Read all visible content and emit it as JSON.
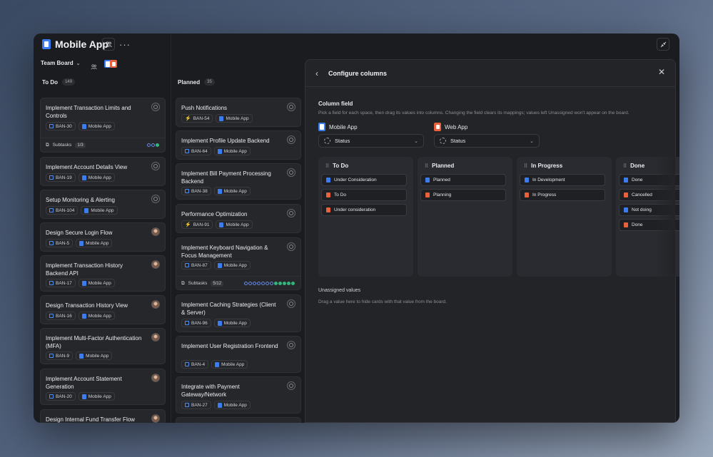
{
  "header": {
    "app_title": "Mobile App",
    "board_name": "Team Board"
  },
  "columns": [
    {
      "name": "To Do",
      "count": "149",
      "cards": [
        {
          "title": "Implement Transaction Limits and Controls",
          "key": "BAN-30",
          "project": "Mobile App",
          "assignee": "empty",
          "subtasks": {
            "label": "Subtasks",
            "count": "1/3",
            "done": 1,
            "total": 3
          }
        },
        {
          "title": "Implement Account Details View",
          "key": "BAN-19",
          "project": "Mobile App",
          "assignee": "empty"
        },
        {
          "title": "Setup Monitoring & Alerting",
          "key": "BAN-104",
          "project": "Mobile App",
          "assignee": "empty"
        },
        {
          "title": "Design Secure Login Flow",
          "key": "BAN-5",
          "project": "Mobile App",
          "assignee": "photo"
        },
        {
          "title": "Implement Transaction History Backend API",
          "key": "BAN-17",
          "project": "Mobile App",
          "assignee": "photo"
        },
        {
          "title": "Design Transaction History View",
          "key": "BAN-16",
          "project": "Mobile App",
          "assignee": "photo"
        },
        {
          "title": "Implement Multi-Factor Authentication (MFA)",
          "key": "BAN-9",
          "project": "Mobile App",
          "assignee": "photo"
        },
        {
          "title": "Implement Account Statement Generation",
          "key": "BAN-20",
          "project": "Mobile App",
          "assignee": "photo"
        },
        {
          "title": "Design Internal Fund Transfer Flow",
          "key": "",
          "project": "",
          "assignee": "photo"
        }
      ]
    },
    {
      "name": "Planned",
      "count": "35",
      "cards": [
        {
          "title": "Push Notifications",
          "key": "BAN-54",
          "project": "Mobile App",
          "assignee": "empty",
          "key_icon": "bolt"
        },
        {
          "title": "Implement Profile Update Backend",
          "key": "BAN-64",
          "project": "Mobile App",
          "assignee": "empty"
        },
        {
          "title": "Implement Bill Payment Processing Backend",
          "key": "BAN-38",
          "project": "Mobile App",
          "assignee": "empty"
        },
        {
          "title": "Performance Optimization",
          "key": "BAN-91",
          "project": "Mobile App",
          "assignee": "empty",
          "key_icon": "bolt"
        },
        {
          "title": "Implement Keyboard Navigation & Focus Management",
          "key": "BAN-87",
          "project": "Mobile App",
          "assignee": "empty",
          "subtasks": {
            "label": "Subtasks",
            "count": "5/12",
            "done": 5,
            "total": 12
          }
        },
        {
          "title": "Implement Caching Strategies (Client & Server)",
          "key": "BAN-96",
          "project": "Mobile App",
          "assignee": "empty"
        },
        {
          "title": "Implement User Registration Frontend",
          "key": "BAN-4",
          "project": "Mobile App",
          "assignee": "empty"
        },
        {
          "title": "Integrate with Payment Gateway/Network",
          "key": "BAN-27",
          "project": "Mobile App",
          "assignee": "empty"
        }
      ]
    }
  ],
  "panel": {
    "title": "Configure columns",
    "column_field_label": "Column field",
    "column_field_help": "Pick a field for each space, then drag its values into columns. Changing the field clears its mappings; values left Unassigned won't appear on the board.",
    "sources": [
      {
        "name": "Mobile App",
        "field": "Status",
        "color": "#3b7df0"
      },
      {
        "name": "Web App",
        "field": "Status",
        "color": "#e8613c"
      }
    ],
    "columns": [
      {
        "name": "To Do",
        "values": [
          {
            "label": "Under Consideration",
            "src": "b"
          },
          {
            "label": "To Do",
            "src": "o"
          },
          {
            "label": "Under consideration",
            "src": "o"
          }
        ]
      },
      {
        "name": "Planned",
        "values": [
          {
            "label": "Planned",
            "src": "b"
          },
          {
            "label": "Planning",
            "src": "o"
          }
        ]
      },
      {
        "name": "In Progress",
        "values": [
          {
            "label": "In Development",
            "src": "b"
          },
          {
            "label": "In Progress",
            "src": "o"
          }
        ]
      },
      {
        "name": "Done",
        "values": [
          {
            "label": "Done",
            "src": "b"
          },
          {
            "label": "Cancelled",
            "src": "o"
          },
          {
            "label": "Not doing",
            "src": "b"
          },
          {
            "label": "Done",
            "src": "o"
          }
        ]
      }
    ],
    "unassigned_label": "Unassigned values",
    "unassigned_help": "Drag a value here to hide cards with that value from the board."
  }
}
